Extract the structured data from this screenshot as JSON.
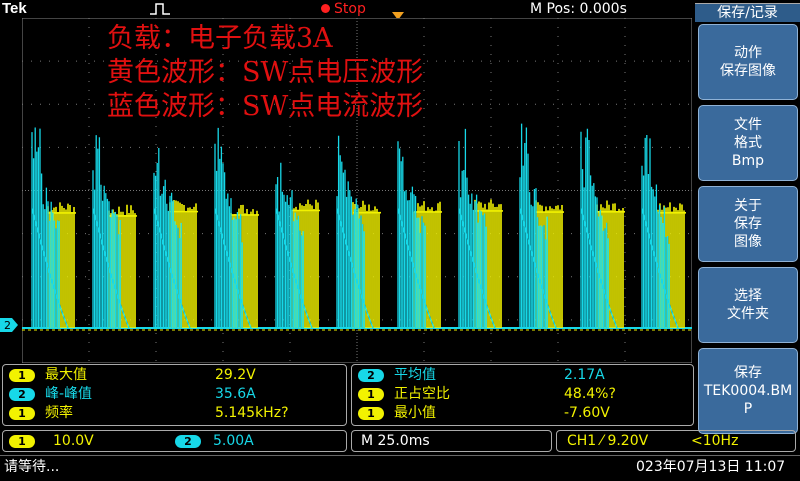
{
  "header": {
    "brand": "Tek",
    "run_state": "Stop",
    "horizontal_position": "M Pos: 0.000s",
    "trigger_marker": "T"
  },
  "colors": {
    "ch1": "#f2f200",
    "ch2": "#17d8e8",
    "annotation": "#e01010",
    "stop": "#ff2020",
    "menu_bg": "#3a6a9c",
    "trigger": "#f0a020"
  },
  "annotation": {
    "line1": "负载：电子负载3A",
    "line2": "黄色波形：SW点电压波形",
    "line3": "蓝色波形：SW点电流波形"
  },
  "channel_marker": "2",
  "menu": {
    "title": "保存/记录",
    "buttons": [
      {
        "label": "动作\n保存图像"
      },
      {
        "label": "文件\n格式\nBmp"
      },
      {
        "label": "关于\n保存\n图像"
      },
      {
        "label": "选择\n文件夹"
      },
      {
        "label": "保存\nTEK0004.BM\nP"
      }
    ]
  },
  "measurements": {
    "left": [
      {
        "ch": "1",
        "label": "最大值",
        "value": "29.2V"
      },
      {
        "ch": "2",
        "label": "峰-峰值",
        "value": "35.6A"
      },
      {
        "ch": "1",
        "label": "频率",
        "value": "5.145kHz?"
      }
    ],
    "right": [
      {
        "ch": "2",
        "label": "平均值",
        "value": "2.17A"
      },
      {
        "ch": "1",
        "label": "正占空比",
        "value": "48.4%?"
      },
      {
        "ch": "1",
        "label": "最小值",
        "value": "-7.60V"
      }
    ]
  },
  "status": {
    "ch1_badge": "1",
    "ch1_scale": "10.0V",
    "ch2_badge": "2",
    "ch2_scale": "5.00A",
    "timebase": "M 25.0ms",
    "trigger": "CH1 ⁄ 9.20V",
    "trigger_freq": "<10Hz"
  },
  "bottom": {
    "message": "请等待...",
    "datetime": "023年07月13日 11:07"
  }
}
